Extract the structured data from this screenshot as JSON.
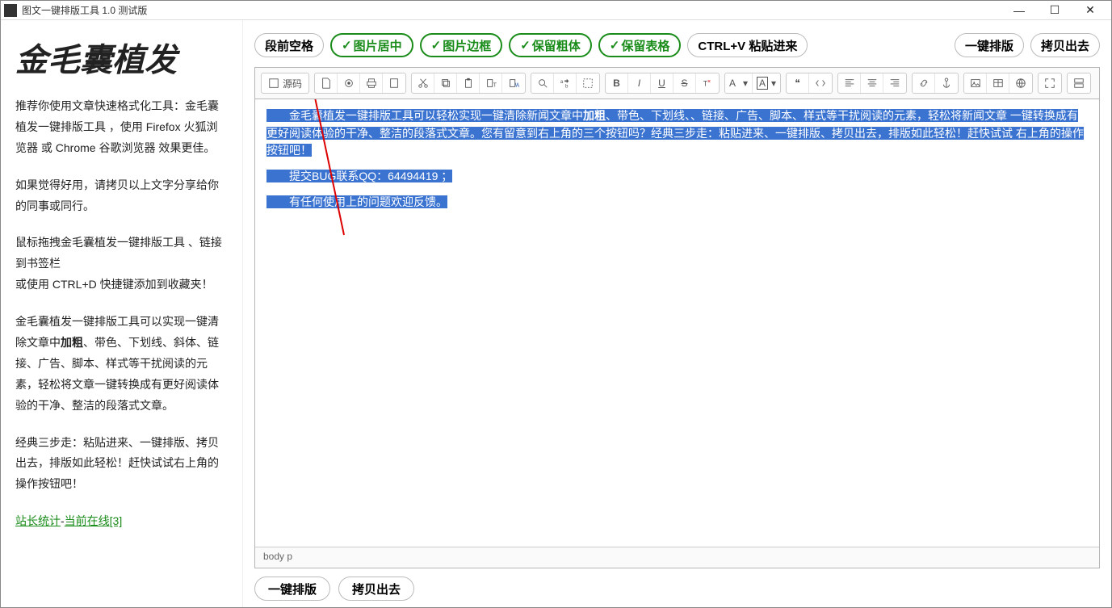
{
  "window": {
    "title": "图文一键排版工具 1.0 测试版"
  },
  "brand": "金毛囊植发",
  "sidebar": {
    "p1": "推荐你使用文章快速格式化工具：金毛囊植发一键排版工具 ，使用 Firefox 火狐浏览器 或 Chrome 谷歌浏览器 效果更佳。",
    "p2": "如果觉得好用，请拷贝以上文字分享给你的同事或同行。",
    "p3a": "鼠标拖拽金毛囊植发一键排版工具 、链接到书签栏",
    "p3b": "或使用 CTRL+D 快捷键添加到收藏夹！",
    "p4_before": "金毛囊植发一键排版工具可以实现一键清除文章中",
    "p4_bold": "加粗",
    "p4_after": "、带色、下划线、斜体、链接、广告、脚本、样式等干扰阅读的元素，轻松将文章一键转换成有更好阅读体验的干净、整洁的段落式文章。",
    "p5": "经典三步走：粘贴进来、一键排版、拷贝出去，排版如此轻松！赶快试试右上角的操作按钮吧！",
    "stats_a": "站长统计",
    "stats_b": "当前在线[3]"
  },
  "opts": {
    "indent": "段前空格",
    "img_center": "图片居中",
    "img_border": "图片边框",
    "keep_bold": "保留粗体",
    "keep_table": "保留表格",
    "paste": "CTRL+V 粘贴进来",
    "typeset": "一键排版",
    "copy": "拷贝出去"
  },
  "tb": {
    "source": "源码"
  },
  "content": {
    "line1_a": "金毛囊植发一键排版工具可以轻松实现一键清除新闻文章中",
    "line1_bold": "加粗",
    "line1_b": "、带色、下划线、、链接、广告、脚本、样式等干扰阅读的元素，轻松将新闻文章 一键转换成有更好阅读体验的干净、整洁的段落式文章。您有留意到右上角的三个按钮吗？经典三步走：粘贴进来、一键排版、拷贝出去，排版如此轻松！赶快试试 右上角的操作按钮吧！",
    "line2": "提交BUG联系QQ：64494419 ；",
    "line3": "有任何使用上的问题欢迎反馈。"
  },
  "status": {
    "path": "body  p"
  },
  "footer": {
    "typeset": "一键排版",
    "copy": "拷贝出去"
  }
}
